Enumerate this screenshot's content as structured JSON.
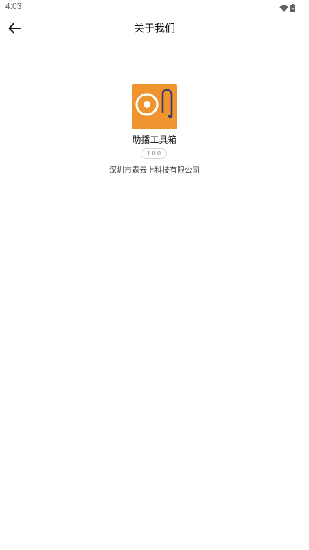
{
  "status_bar": {
    "time": "4:03",
    "icons": [
      "wifi-icon",
      "battery-icon"
    ]
  },
  "app_bar": {
    "back_icon": "arrow-left-icon",
    "title": "关于我们"
  },
  "about": {
    "app_name": "助播工具箱",
    "version": "1.0.0",
    "company": "深圳市霖云上科技有限公司",
    "logo": {
      "icon": "disc-and-headphone-logo",
      "background_color": "#f09430",
      "ring_color": "#ffffff",
      "cable_color": "#3b3b6b"
    }
  }
}
